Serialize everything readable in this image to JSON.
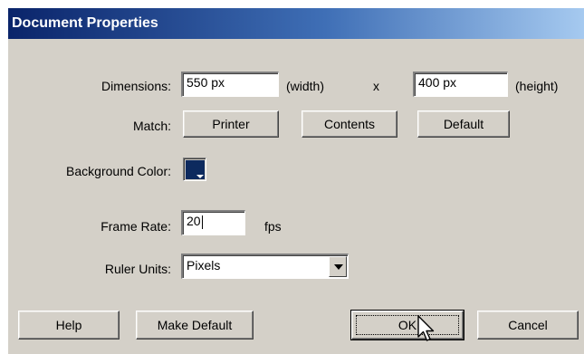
{
  "dialog": {
    "title": "Document Properties"
  },
  "dimensions": {
    "label": "Dimensions:",
    "width_value": "550 px",
    "width_unit": "(width)",
    "separator": "x",
    "height_value": "400 px",
    "height_unit": "(height)"
  },
  "match": {
    "label": "Match:",
    "printer_label": "Printer",
    "contents_label": "Contents",
    "default_label": "Default"
  },
  "background": {
    "label": "Background Color:",
    "color": "#0d2a5e"
  },
  "frame_rate": {
    "label": "Frame Rate:",
    "value": "20",
    "unit": "fps"
  },
  "ruler_units": {
    "label": "Ruler Units:",
    "selected": "Pixels"
  },
  "buttons": {
    "help": "Help",
    "make_default": "Make Default",
    "ok": "OK",
    "cancel": "Cancel"
  },
  "icons": {
    "dropdown": "chevron-down-icon",
    "cursor": "mouse-pointer-icon"
  }
}
